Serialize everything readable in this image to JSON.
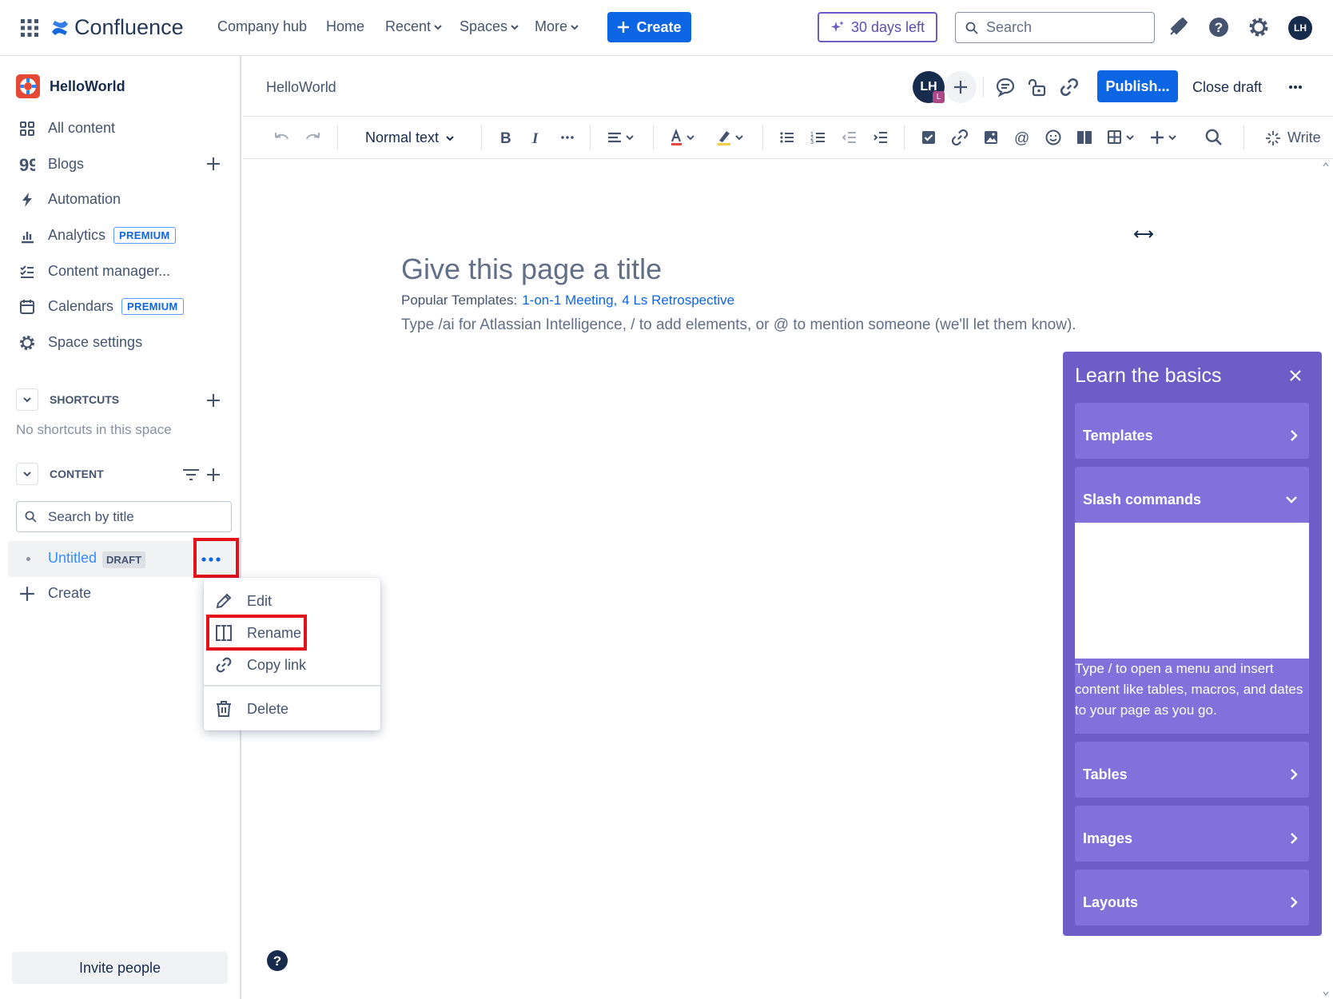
{
  "topnav": {
    "app_name": "Confluence",
    "links": [
      "Company hub",
      "Home",
      "Recent",
      "Spaces",
      "More"
    ],
    "create_label": "Create",
    "trial_label": "30 days left",
    "search_placeholder": "Search",
    "avatar_initials": "LH"
  },
  "sidebar": {
    "space_name": "HelloWorld",
    "items": [
      {
        "label": "All content",
        "icon": "grid-icon"
      },
      {
        "label": "Blogs",
        "icon": "quote-icon"
      },
      {
        "label": "Automation",
        "icon": "bolt-icon"
      },
      {
        "label": "Analytics",
        "icon": "bar-chart-icon",
        "badge": "PREMIUM"
      },
      {
        "label": "Content manager...",
        "icon": "checklist-icon"
      },
      {
        "label": "Calendars",
        "icon": "calendar-icon",
        "badge": "PREMIUM"
      },
      {
        "label": "Space settings",
        "icon": "gear-icon"
      }
    ],
    "shortcuts_title": "SHORTCUTS",
    "shortcuts_empty": "No shortcuts in this space",
    "content_title": "CONTENT",
    "content_search_placeholder": "Search by title",
    "tree_item_title": "Untitled",
    "tree_item_badge": "DRAFT",
    "create_label": "Create",
    "invite_label": "Invite people"
  },
  "context_menu": {
    "items": [
      "Edit",
      "Rename",
      "Copy link",
      "Delete"
    ]
  },
  "editor_header": {
    "breadcrumb": "HelloWorld",
    "avatar_initials": "LH",
    "avatar_sub": "L",
    "publish_label": "Publish...",
    "close_draft_label": "Close draft"
  },
  "toolbar": {
    "text_style": "Normal text",
    "write_label": "Write"
  },
  "editor": {
    "title_placeholder": "Give this page a title",
    "templates_prefix": "Popular Templates:",
    "template_links": [
      "1-on-1 Meeting",
      "4 Ls Retrospective"
    ],
    "body_placeholder": "Type /ai for Atlassian Intelligence, / to add elements, or @ to mention someone (we'll let them know)."
  },
  "learn_panel": {
    "title": "Learn the basics",
    "sections": [
      "Templates",
      "Slash commands",
      "Tables",
      "Images",
      "Layouts"
    ],
    "slash_description": "Type / to open a menu and insert content like tables, macros, and dates to your page as you go."
  },
  "colors": {
    "brand_blue": "#0c66e4",
    "discovery_purple": "#6e5dc6",
    "highlight_red": "#e2111b"
  }
}
